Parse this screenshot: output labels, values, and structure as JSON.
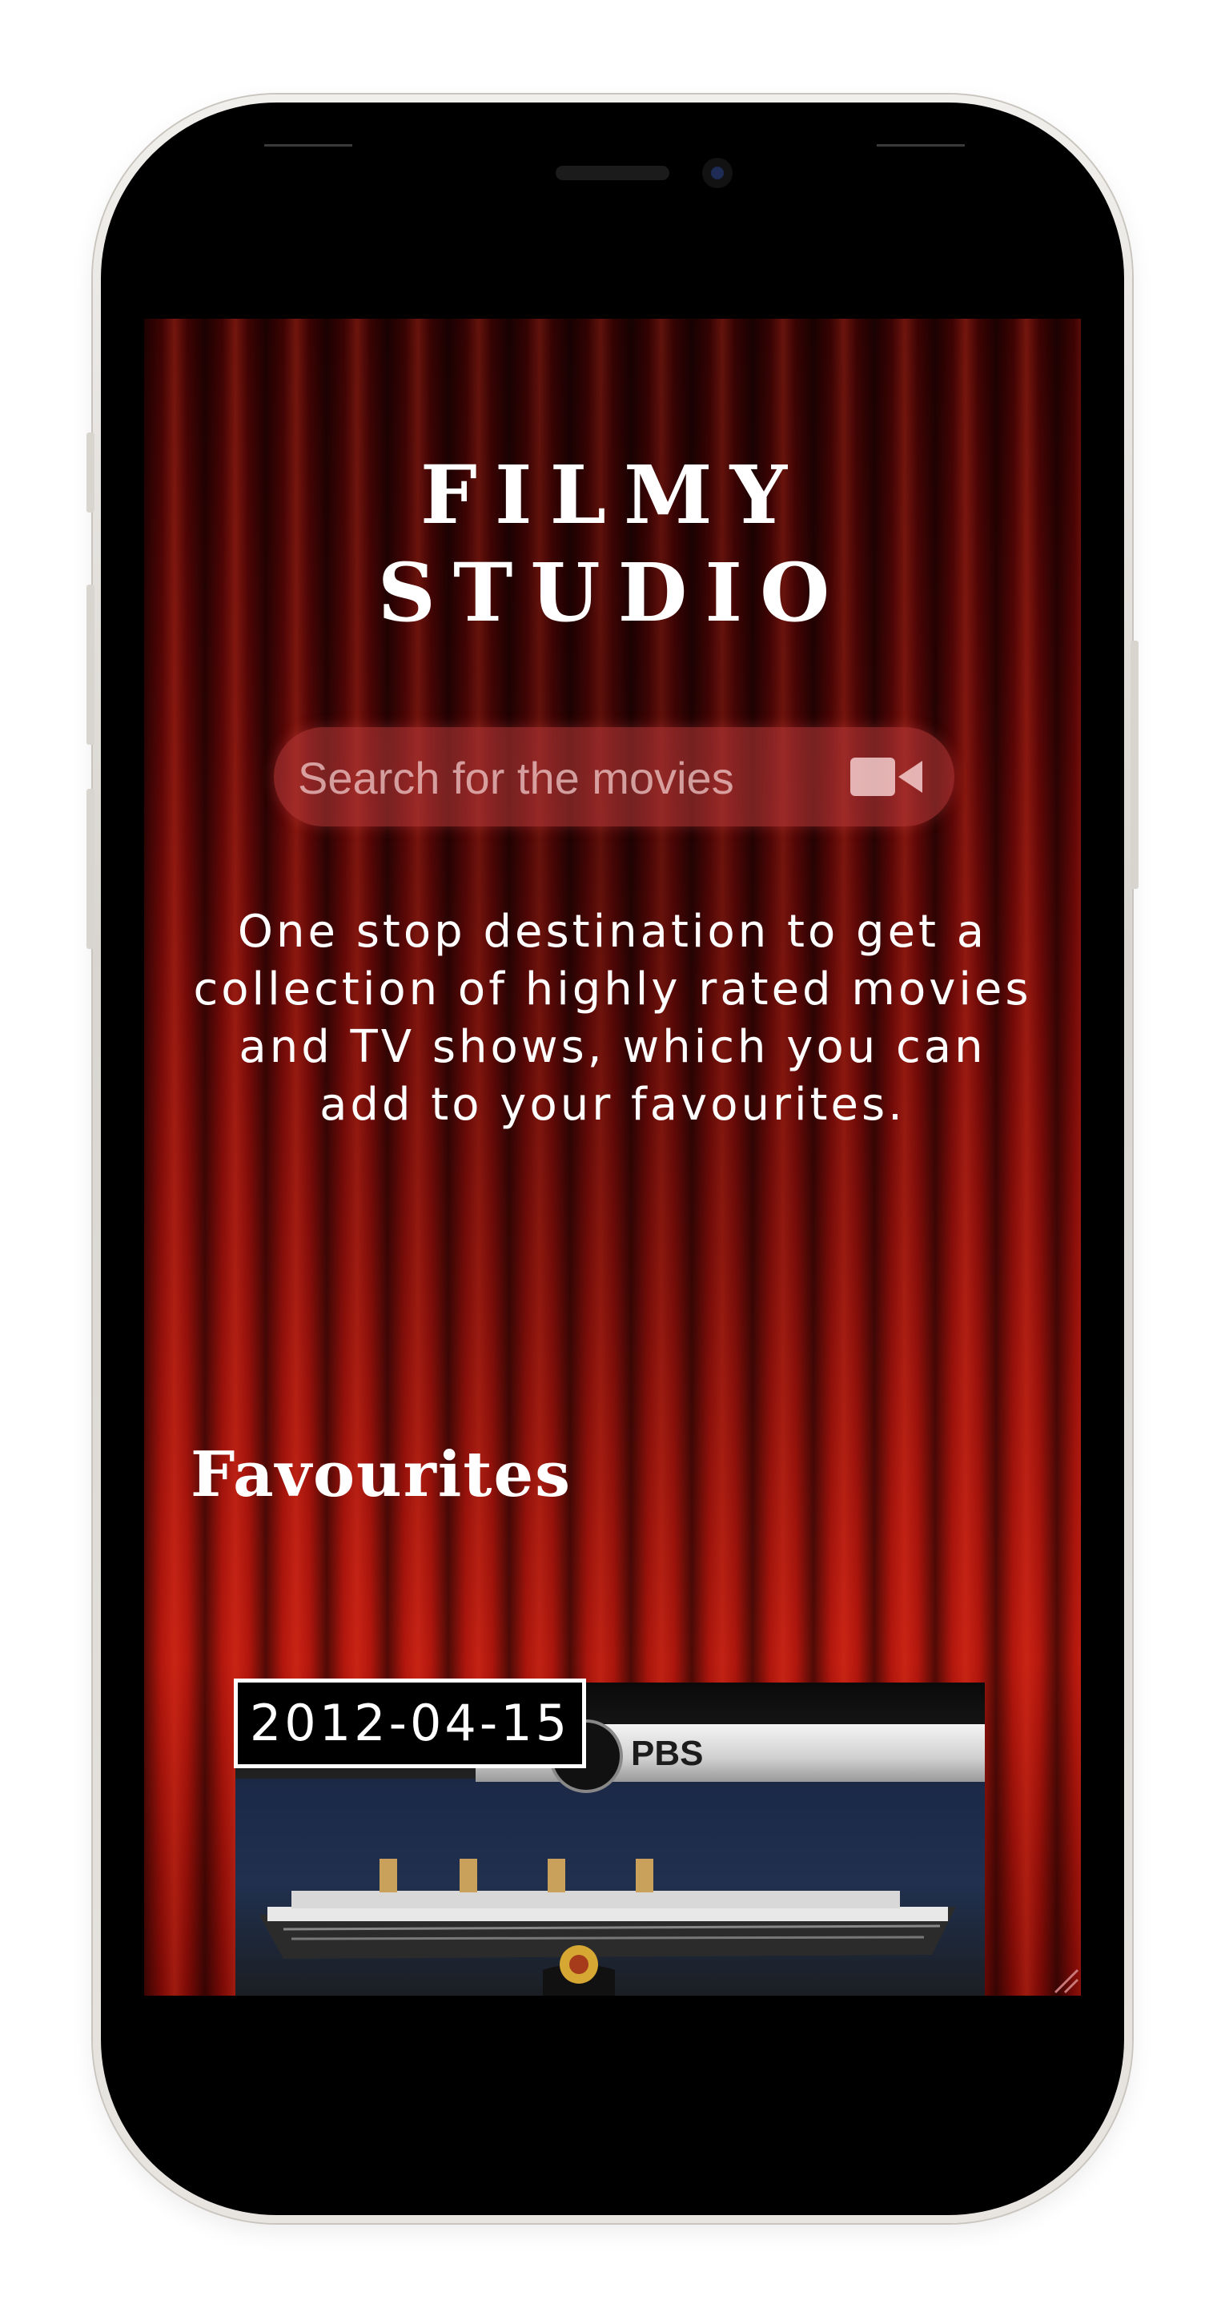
{
  "app": {
    "title_line1": "FILMY",
    "title_line2": "STUDIO"
  },
  "search": {
    "placeholder": "Search for the movies",
    "icon": "video-camera-icon"
  },
  "tagline": "One stop destination to get a collection of highly rated movies and TV shows, which you can add to your favourites.",
  "favourites": {
    "heading": "Favourites",
    "items": [
      {
        "date": "2012-04-15",
        "network_label": "PBS"
      }
    ]
  },
  "colors": {
    "curtain_dark": "#3d0303",
    "curtain_red": "#b5170d",
    "text": "#ffffff",
    "search_bg": "#be3c3c"
  }
}
